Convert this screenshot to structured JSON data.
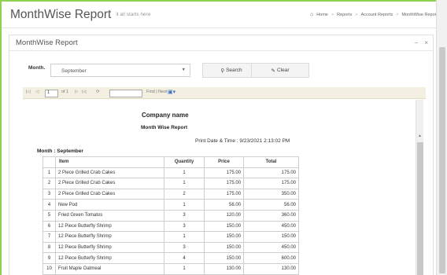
{
  "header": {
    "title": "MonthWise Report",
    "subtitle": "it all starts here",
    "breadcrumbs": [
      "Home",
      "Reports",
      "Account Reports",
      "MonthWise Report"
    ]
  },
  "panel": {
    "title": "MonthWise Report",
    "minimize_label": "−",
    "close_label": "×"
  },
  "form": {
    "month_label": "Month.",
    "month_value": "September",
    "search_label": "Search",
    "clear_label": "Clear"
  },
  "toolbar": {
    "first": "|◁",
    "prev": "◁",
    "page_value": "1",
    "of_pages": "of 1",
    "next": "▷",
    "last": "▷|",
    "refresh": "⟳",
    "find_next": "Find | Next"
  },
  "report": {
    "company": "Company name",
    "title": "Month Wise Report",
    "print_date": "Print Date & Time : 9/23/2021 2:13:02 PM",
    "month": "Month : September",
    "columns": [
      "",
      "Item",
      "Quantity",
      "Price",
      "Total"
    ],
    "rows": [
      [
        "1",
        "2 Piece Grilled Crab Cakes",
        "1",
        "175.00",
        "175.00"
      ],
      [
        "2",
        "2 Piece Grilled Crab Cakes",
        "1",
        "175.00",
        "175.00"
      ],
      [
        "3",
        "2 Piece Grilled Crab Cakes",
        "2",
        "175.00",
        "350.00"
      ],
      [
        "4",
        "New Pod",
        "1",
        "56.00",
        "56.00"
      ],
      [
        "5",
        "Fried Green Tomatos",
        "3",
        "120.00",
        "360.00"
      ],
      [
        "6",
        "12 Piece Butterfly Shrimp",
        "3",
        "150.00",
        "450.00"
      ],
      [
        "7",
        "12 Piece Butterfly Shrimp",
        "1",
        "150.00",
        "150.00"
      ],
      [
        "8",
        "12 Piece Butterfly Shrimp",
        "3",
        "150.00",
        "450.00"
      ],
      [
        "9",
        "12 Piece Butterfly Shrimp",
        "4",
        "150.00",
        "600.00"
      ],
      [
        "10",
        "Fruit Maple Oatmeal",
        "1",
        "130.00",
        "130.00"
      ]
    ]
  },
  "colors": {
    "frame_border": "#8fd14f",
    "toolbar_bg": "#f3f0e1"
  }
}
